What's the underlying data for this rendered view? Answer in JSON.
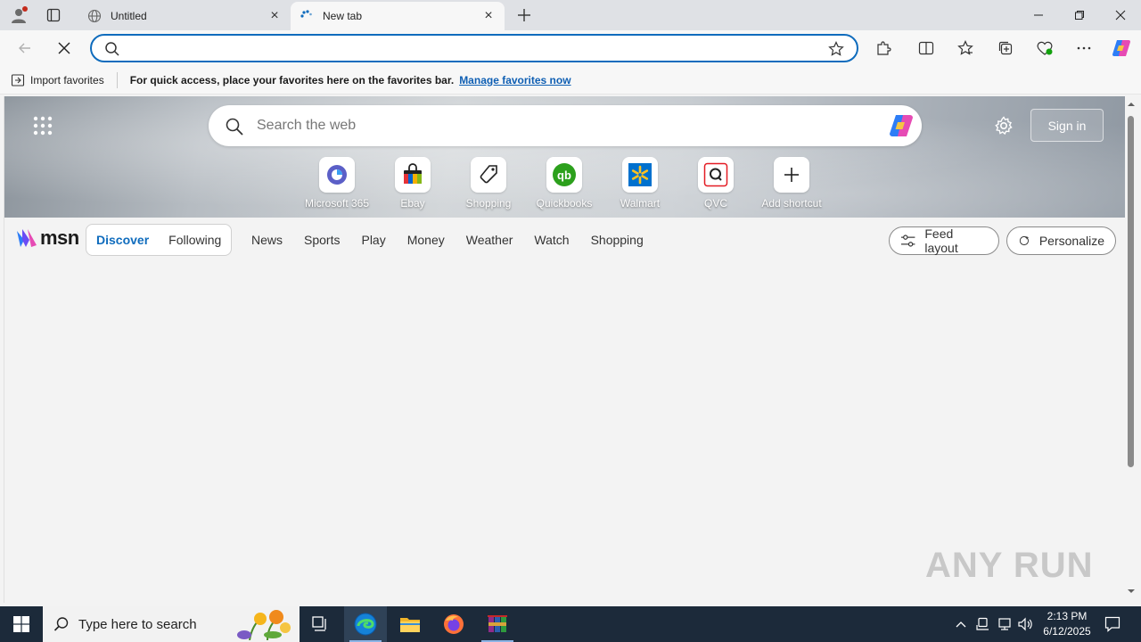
{
  "tabs": [
    {
      "title": "Untitled",
      "active": false
    },
    {
      "title": "New tab",
      "active": true
    }
  ],
  "favorites_bar": {
    "import_label": "Import favorites",
    "message": "For quick access, place your favorites here on the favorites bar.",
    "manage_link": "Manage favorites now"
  },
  "ntp": {
    "search_placeholder": "Search the web",
    "sign_in_label": "Sign in",
    "shortcuts": [
      {
        "label": "Microsoft 365",
        "icon": "microsoft-365-icon"
      },
      {
        "label": "Ebay",
        "icon": "ebay-icon"
      },
      {
        "label": "Shopping",
        "icon": "shopping-tag-icon"
      },
      {
        "label": "Quickbooks",
        "icon": "quickbooks-icon"
      },
      {
        "label": "Walmart",
        "icon": "walmart-icon"
      },
      {
        "label": "QVC",
        "icon": "qvc-icon"
      },
      {
        "label": "Add shortcut",
        "icon": "plus-icon"
      }
    ]
  },
  "msn": {
    "logo_text": "msn",
    "feed_tabs": [
      "Discover",
      "Following"
    ],
    "selected_feed_tab": "Discover",
    "links": [
      "News",
      "Sports",
      "Play",
      "Money",
      "Weather",
      "Watch",
      "Shopping"
    ],
    "feed_layout_label": "Feed layout",
    "personalize_label": "Personalize"
  },
  "watermark": "ANY RUN",
  "taskbar": {
    "search_placeholder": "Type here to search",
    "time": "2:13 PM",
    "date": "6/12/2025"
  },
  "colors": {
    "accent": "#0f6cbd",
    "taskbar": "#1c2a3a"
  }
}
